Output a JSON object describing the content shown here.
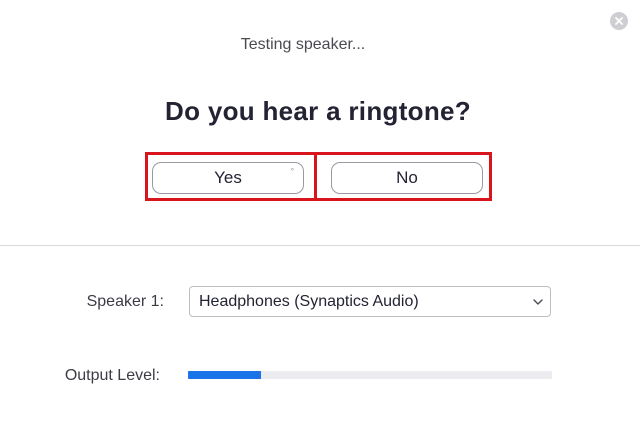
{
  "dialog": {
    "status_text": "Testing speaker...",
    "question": "Do you hear a ringtone?",
    "yes_label": "Yes",
    "no_label": "No",
    "yes_indicator": "°"
  },
  "settings": {
    "speaker_label": "Speaker 1:",
    "speaker_value": "Headphones (Synaptics Audio)",
    "output_level_label": "Output Level:",
    "output_level_fraction": 0.2
  },
  "icons": {
    "close": "close-icon",
    "dropdown": "chevron-down-icon"
  },
  "colors": {
    "highlight_border": "#d8141c",
    "level_fill": "#1a74e8",
    "close_bg": "#cfcfd3"
  }
}
